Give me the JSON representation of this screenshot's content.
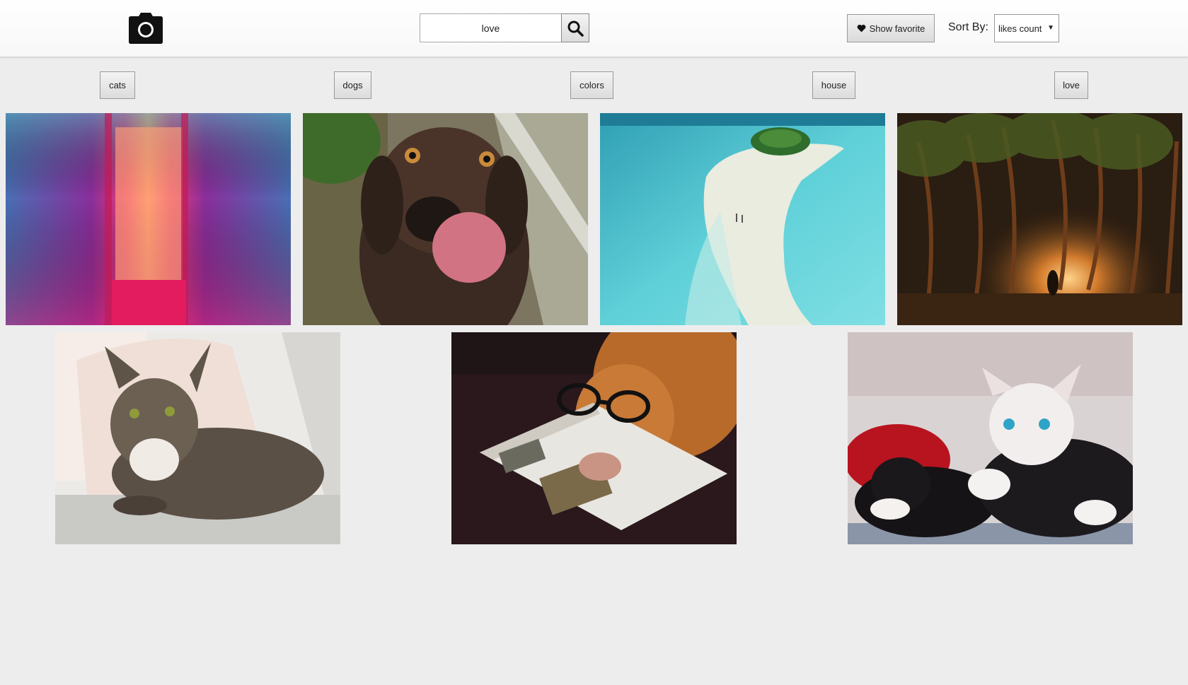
{
  "header": {
    "logo_icon": "camera-icon",
    "search": {
      "value": "love",
      "placeholder": "",
      "button_icon": "search-icon"
    },
    "favorite_button": {
      "icon": "heart-icon",
      "label": "Show favorite"
    },
    "sort": {
      "label": "Sort By:",
      "selected": "likes count",
      "caret": "▼"
    }
  },
  "tags": [
    "cats",
    "dogs",
    "colors",
    "house",
    "love"
  ],
  "gallery": {
    "photos": [
      {
        "subject": "neon-corridor"
      },
      {
        "subject": "dog-licking"
      },
      {
        "subject": "tropical-island"
      },
      {
        "subject": "palm-trees-night"
      },
      {
        "subject": "tabby-cat"
      },
      {
        "subject": "dog-with-glasses"
      },
      {
        "subject": "two-kittens"
      }
    ]
  },
  "colors": {
    "page_background": "#ededed",
    "header_background": "#f9f9f9",
    "icon": "#111111"
  }
}
